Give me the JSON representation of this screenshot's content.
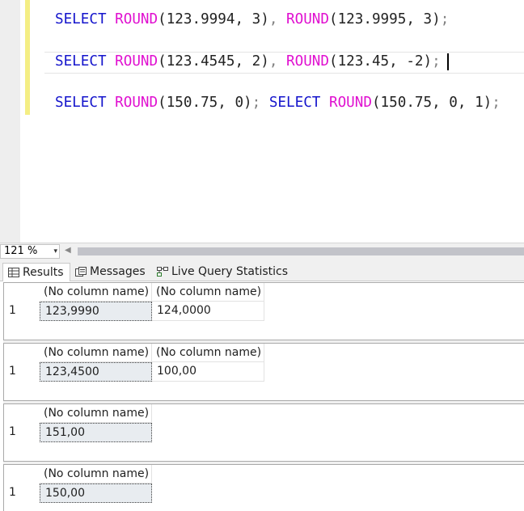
{
  "editor": {
    "line1": {
      "kw": "SELECT",
      "fn1": "ROUND",
      "args1": "(123.9994, 3)",
      "sep": ", ",
      "fn2": "ROUND",
      "args2": "(123.9995, 3)",
      "end": ";"
    },
    "line2": {
      "kw": "SELECT",
      "fn1": "ROUND",
      "args1": "(123.4545, 2)",
      "sep": ", ",
      "fn2": "ROUND",
      "args2": "(123.45, -2)",
      "end": ";"
    },
    "line3": {
      "kw1": "SELECT",
      "fn1": "ROUND",
      "args1": "(150.75, 0)",
      "sep": "; ",
      "kw2": "SELECT",
      "fn2": "ROUND",
      "args2": "(150.75, 0, 1)",
      "end": ";"
    }
  },
  "zoom": {
    "value": "121 %",
    "arrow": "▾",
    "scroll_left": "◀"
  },
  "tabs": [
    {
      "label": "Results",
      "icon": "grid-icon",
      "active": true
    },
    {
      "label": "Messages",
      "icon": "messages-icon",
      "active": false
    },
    {
      "label": "Live Query Statistics",
      "icon": "live-query-statistics-icon",
      "active": false
    }
  ],
  "results": [
    {
      "columns": [
        "(No column name)",
        "(No column name)"
      ],
      "rows": [
        {
          "num": "1",
          "values": [
            "123,9990",
            "124,0000"
          ]
        }
      ]
    },
    {
      "columns": [
        "(No column name)",
        "(No column name)"
      ],
      "rows": [
        {
          "num": "1",
          "values": [
            "123,4500",
            "100,00"
          ]
        }
      ]
    },
    {
      "columns": [
        "(No column name)"
      ],
      "rows": [
        {
          "num": "1",
          "values": [
            "151,00"
          ]
        }
      ]
    },
    {
      "columns": [
        "(No column name)"
      ],
      "rows": [
        {
          "num": "1",
          "values": [
            "150,00"
          ]
        }
      ]
    }
  ],
  "colors": {
    "keyword": "#1515cc",
    "function": "#e010d0",
    "change_bar": "#f4ee84",
    "selected_cell": "#e8ecf0"
  }
}
